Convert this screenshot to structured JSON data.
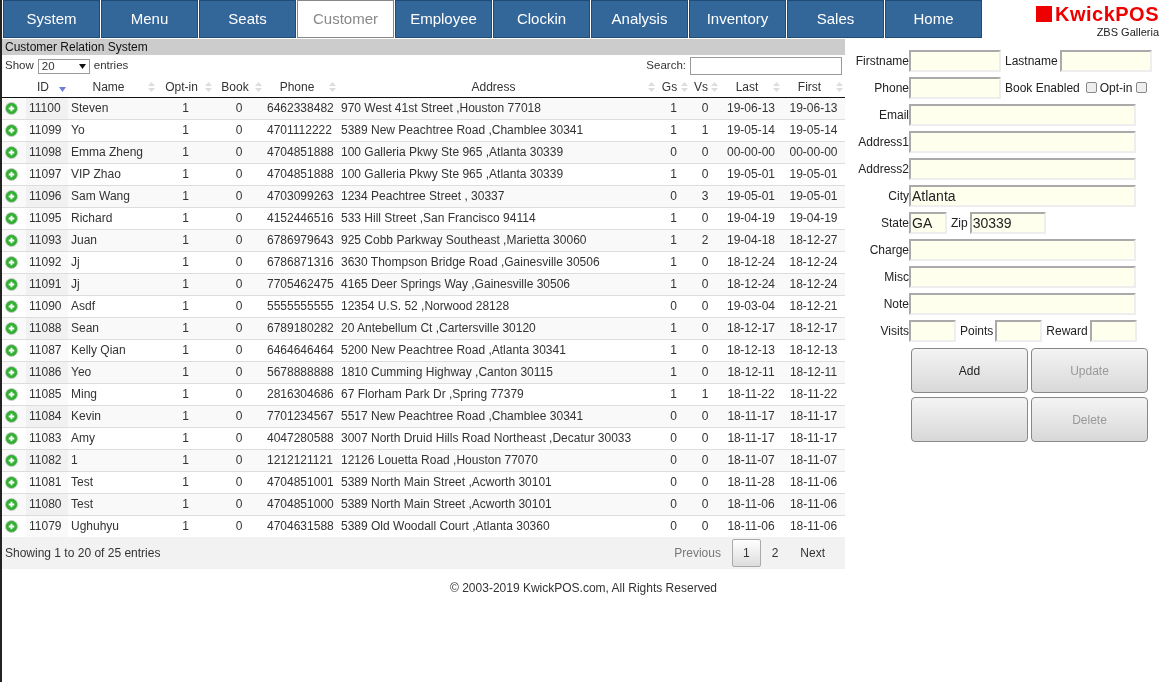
{
  "nav": [
    {
      "label": "System",
      "selected": false
    },
    {
      "label": "Menu",
      "selected": false
    },
    {
      "label": "Seats",
      "selected": false
    },
    {
      "label": "Customer",
      "selected": true
    },
    {
      "label": "Employee",
      "selected": false
    },
    {
      "label": "Clockin",
      "selected": false
    },
    {
      "label": "Analysis",
      "selected": false
    },
    {
      "label": "Inventory",
      "selected": false
    },
    {
      "label": "Sales",
      "selected": false
    },
    {
      "label": "Home",
      "selected": false
    }
  ],
  "logo": {
    "name": "KwickPOS",
    "location": "ZBS Galleria"
  },
  "section_title": "Customer Relation System",
  "length_control": {
    "before": "Show",
    "value": "20",
    "after": "entries"
  },
  "search": {
    "label": "Search:"
  },
  "table": {
    "columns": [
      {
        "label": "ID",
        "sorted": true
      },
      {
        "label": "Name",
        "sorted": false
      },
      {
        "label": "Opt-in",
        "sorted": false
      },
      {
        "label": "Book",
        "sorted": false
      },
      {
        "label": "Phone",
        "sorted": false
      },
      {
        "label": "Address",
        "sorted": false
      },
      {
        "label": "Gs",
        "sorted": false
      },
      {
        "label": "Vs",
        "sorted": false
      },
      {
        "label": "Last",
        "sorted": false
      },
      {
        "label": "First",
        "sorted": false
      }
    ],
    "rows": [
      [
        "11100",
        "Steven",
        "1",
        "0",
        "6462338482",
        "970 West 41st Street ,Houston 77018",
        "1",
        "0",
        "19-06-13",
        "19-06-13"
      ],
      [
        "11099",
        "Yo",
        "1",
        "0",
        "4701112222",
        "5389 New Peachtree Road ,Chamblee 30341",
        "1",
        "1",
        "19-05-14",
        "19-05-14"
      ],
      [
        "11098",
        "Emma Zheng",
        "1",
        "0",
        "4704851888",
        "100 Galleria Pkwy Ste 965 ,Atlanta 30339",
        "0",
        "0",
        "00-00-00",
        "00-00-00"
      ],
      [
        "11097",
        "VIP Zhao",
        "1",
        "0",
        "4704851888",
        "100 Galleria Pkwy Ste 965 ,Atlanta 30339",
        "1",
        "0",
        "19-05-01",
        "19-05-01"
      ],
      [
        "11096",
        "Sam Wang",
        "1",
        "0",
        "4703099263",
        "1234 Peachtree Street , 30337",
        "0",
        "3",
        "19-05-01",
        "19-05-01"
      ],
      [
        "11095",
        "Richard",
        "1",
        "0",
        "4152446516",
        "533 Hill Street ,San Francisco 94114",
        "1",
        "0",
        "19-04-19",
        "19-04-19"
      ],
      [
        "11093",
        "Juan",
        "1",
        "0",
        "6786979643",
        "925 Cobb Parkway Southeast ,Marietta 30060",
        "1",
        "2",
        "19-04-18",
        "18-12-27"
      ],
      [
        "11092",
        "Jj",
        "1",
        "0",
        "6786871316",
        "3630 Thompson Bridge Road ,Gainesville 30506",
        "1",
        "0",
        "18-12-24",
        "18-12-24"
      ],
      [
        "11091",
        "Jj",
        "1",
        "0",
        "7705462475",
        "4165 Deer Springs Way ,Gainesville 30506",
        "1",
        "0",
        "18-12-24",
        "18-12-24"
      ],
      [
        "11090",
        "Asdf",
        "1",
        "0",
        "5555555555",
        "12354 U.S. 52 ,Norwood 28128",
        "0",
        "0",
        "19-03-04",
        "18-12-21"
      ],
      [
        "11088",
        "Sean",
        "1",
        "0",
        "6789180282",
        "20 Antebellum Ct ,Cartersville 30120",
        "1",
        "0",
        "18-12-17",
        "18-12-17"
      ],
      [
        "11087",
        "Kelly Qian",
        "1",
        "0",
        "6464646464",
        "5200 New Peachtree Road ,Atlanta 30341",
        "1",
        "0",
        "18-12-13",
        "18-12-13"
      ],
      [
        "11086",
        "Yeo",
        "1",
        "0",
        "5678888888",
        "1810 Cumming Highway ,Canton 30115",
        "1",
        "0",
        "18-12-11",
        "18-12-11"
      ],
      [
        "11085",
        "Ming",
        "1",
        "0",
        "2816304686",
        "67 Florham Park Dr ,Spring 77379",
        "1",
        "1",
        "18-11-22",
        "18-11-22"
      ],
      [
        "11084",
        "Kevin",
        "1",
        "0",
        "7701234567",
        "5517 New Peachtree Road ,Chamblee 30341",
        "0",
        "0",
        "18-11-17",
        "18-11-17"
      ],
      [
        "11083",
        "Amy",
        "1",
        "0",
        "4047280588",
        "3007 North Druid Hills Road Northeast ,Decatur 30033",
        "0",
        "0",
        "18-11-17",
        "18-11-17"
      ],
      [
        "11082",
        "1",
        "1",
        "0",
        "1212121121",
        "12126 Louetta Road ,Houston 77070",
        "0",
        "0",
        "18-11-07",
        "18-11-07"
      ],
      [
        "11081",
        "Test",
        "1",
        "0",
        "4704851001",
        "5389 North Main Street ,Acworth 30101",
        "0",
        "0",
        "18-11-28",
        "18-11-06"
      ],
      [
        "11080",
        "Test",
        "1",
        "0",
        "4704851000",
        "5389 North Main Street ,Acworth 30101",
        "0",
        "0",
        "18-11-06",
        "18-11-06"
      ],
      [
        "11079",
        "Ughuhyu",
        "1",
        "0",
        "4704631588",
        "5389 Old Woodall Court ,Atlanta 30360",
        "0",
        "0",
        "18-11-06",
        "18-11-06"
      ]
    ]
  },
  "info": "Showing 1 to 20 of 25 entries",
  "pagination": [
    {
      "label": "Previous",
      "kind": "prev",
      "disabled": true,
      "selected": false
    },
    {
      "label": "1",
      "kind": "page",
      "disabled": false,
      "selected": true
    },
    {
      "label": "2",
      "kind": "page",
      "disabled": false,
      "selected": false
    },
    {
      "label": "Next",
      "kind": "next",
      "disabled": false,
      "selected": false
    }
  ],
  "form": [
    [
      {
        "kind": "field",
        "label": "Firstname"
      },
      {
        "kind": "field",
        "label": "Lastname"
      }
    ],
    [
      {
        "kind": "field",
        "label": "Phone"
      },
      {
        "kind": "checkbox",
        "label": "Book Enabled",
        "checked": false
      },
      {
        "kind": "checkbox",
        "label": "Opt-in",
        "checked": false
      }
    ],
    [
      {
        "kind": "field",
        "label": "Email"
      }
    ],
    [
      {
        "kind": "field",
        "label": "Address1"
      }
    ],
    [
      {
        "kind": "field",
        "label": "Address2"
      }
    ],
    [
      {
        "kind": "field",
        "label": "City",
        "value": "Atlanta"
      }
    ],
    [
      {
        "kind": "field",
        "label": "State",
        "value": "GA"
      },
      {
        "kind": "field",
        "label": "Zip",
        "value": "30339"
      }
    ],
    [
      {
        "kind": "field",
        "label": "Charge"
      }
    ],
    [
      {
        "kind": "field",
        "label": "Misc"
      }
    ],
    [
      {
        "kind": "field",
        "label": "Note"
      }
    ],
    [
      {
        "kind": "field",
        "label": "Visits"
      },
      {
        "kind": "field",
        "label": "Points"
      },
      {
        "kind": "field",
        "label": "Reward"
      }
    ]
  ],
  "buttons": [
    {
      "kind": "text",
      "label": "Add",
      "disabled": false
    },
    {
      "kind": "text",
      "label": "Update",
      "disabled": true
    },
    {
      "kind": "blank"
    },
    {
      "kind": "text",
      "label": "Delete",
      "disabled": true
    }
  ],
  "footer": "© 2003-2019 KwickPOS.com, All Rights Reserved"
}
